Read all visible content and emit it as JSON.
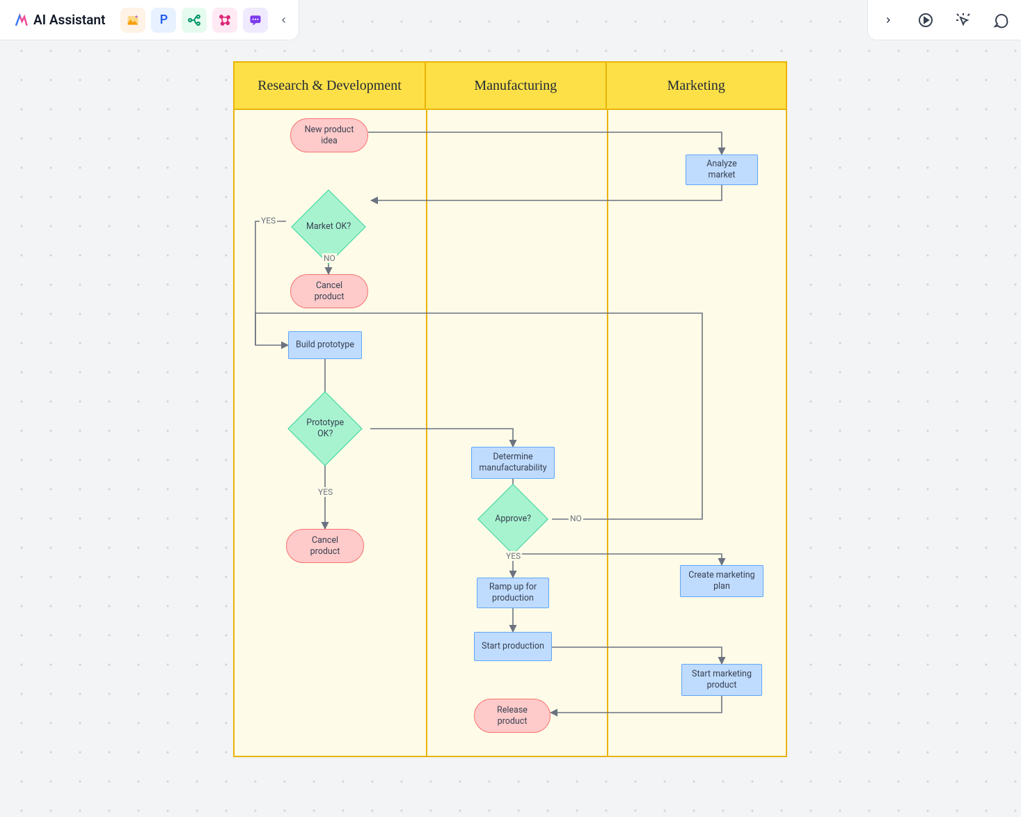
{
  "app": {
    "title": "AI Assistant"
  },
  "swimlanes": [
    "Research & Development",
    "Manufacturing",
    "Marketing"
  ],
  "nodes": {
    "newIdea": "New product idea",
    "analyzeMarket": "Analyze market",
    "marketOk": "Market OK?",
    "cancel1": "Cancel product",
    "buildProto": "Build prototype",
    "protoOk": "Prototype OK?",
    "cancel2": "Cancel product",
    "determine": "Determine manufacturability",
    "approve": "Approve?",
    "marketingPlan": "Create marketing plan",
    "rampUp": "Ramp up for production",
    "startProd": "Start production",
    "startMkt": "Start marketing product",
    "release": "Release product"
  },
  "labels": {
    "yes": "YES",
    "no": "NO"
  }
}
